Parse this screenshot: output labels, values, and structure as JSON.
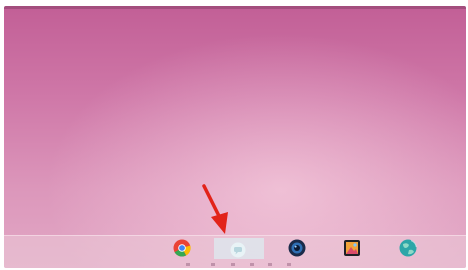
{
  "desktop": {
    "wallpaper_colors": [
      "#c25f96",
      "#dc97bb"
    ]
  },
  "dock": {
    "items": [
      {
        "name": "chrome-icon"
      },
      {
        "name": "messages-app-icon",
        "state": "highlighted"
      },
      {
        "name": "camera-app-icon"
      },
      {
        "name": "gallery-app-icon"
      },
      {
        "name": "globe-app-icon"
      }
    ]
  },
  "annotation": {
    "arrow_color": "#e2231a",
    "points_to": "messages-app-icon"
  }
}
